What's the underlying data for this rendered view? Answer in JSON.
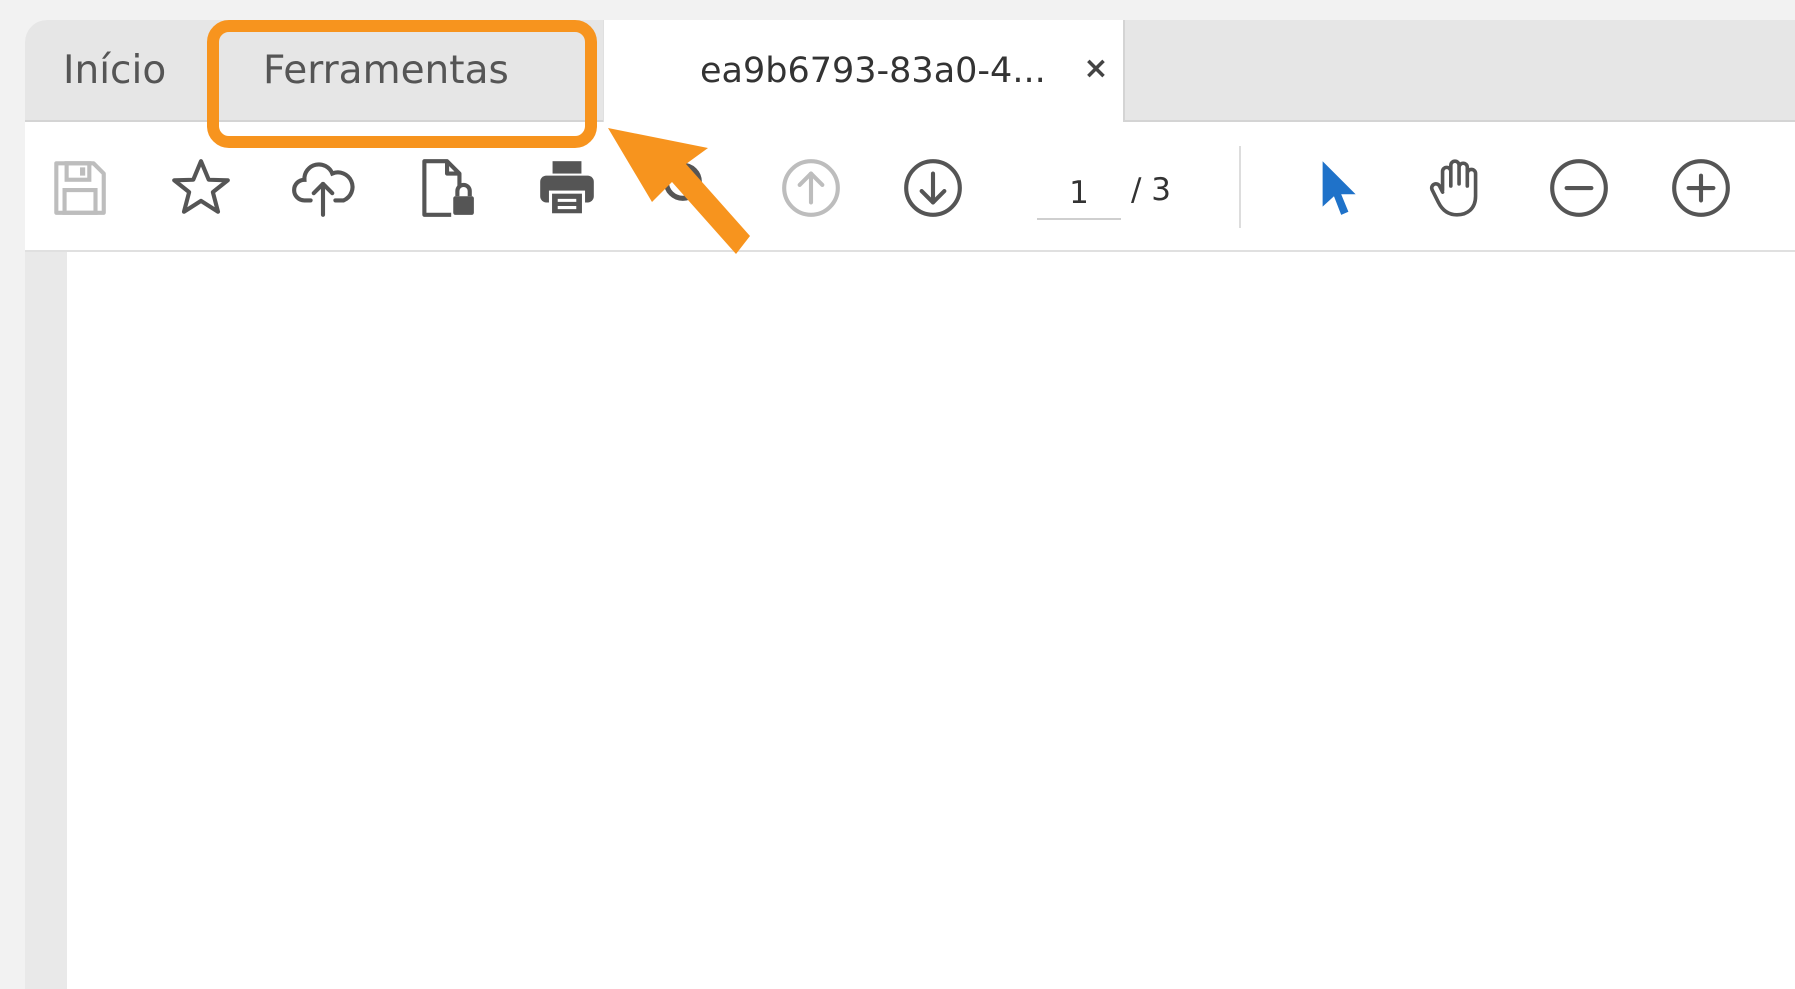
{
  "tabs": {
    "home_label": "Início",
    "tools_label": "Ferramentas",
    "document_label": "ea9b6793-83a0-4...",
    "close_glyph": "×"
  },
  "toolbar": {
    "icons": [
      "save-icon",
      "star-icon",
      "cloud-upload-icon",
      "protect-document-icon",
      "print-icon",
      "search-icon",
      "page-up-icon",
      "page-down-icon",
      "select-cursor-icon",
      "hand-icon",
      "zoom-out-icon",
      "zoom-in-icon"
    ],
    "page_current": "1",
    "page_total": "/ 3"
  },
  "annotation": {
    "highlight_color": "#f7941e"
  },
  "colors": {
    "cursor_accent": "#1f72c9",
    "icon_default": "#555555",
    "icon_disabled": "#bdbdbd"
  }
}
